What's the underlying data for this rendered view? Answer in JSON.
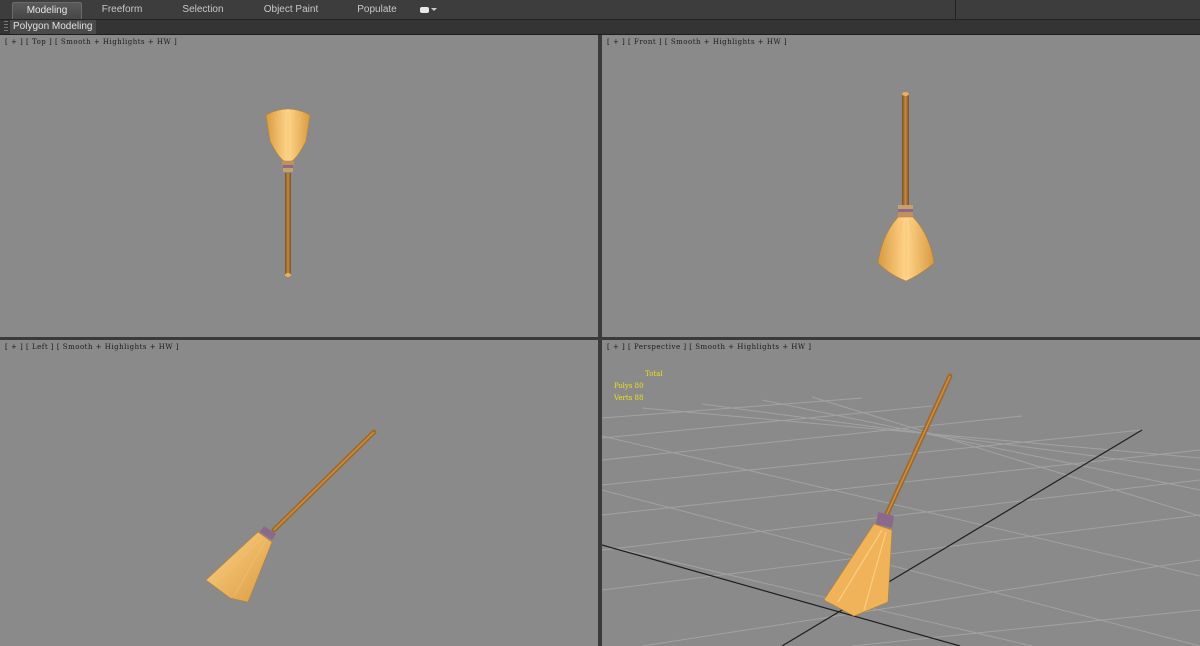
{
  "ribbon": {
    "tabs": [
      {
        "label": "Modeling",
        "active": true
      },
      {
        "label": "Freeform",
        "active": false
      },
      {
        "label": "Selection",
        "active": false
      },
      {
        "label": "Object Paint",
        "active": false
      },
      {
        "label": "Populate",
        "active": false
      }
    ],
    "overflow_icon": "dropdown-toggle-icon"
  },
  "subpanel": {
    "title": "Polygon Modeling"
  },
  "viewports": {
    "top": {
      "label": "[ + ] [ Top ] [ Smooth + Highlights + HW ]"
    },
    "front": {
      "label": "[ + ] [ Front ] [ Smooth + Highlights + HW ]"
    },
    "left": {
      "label": "[ + ] [ Left ] [ Smooth + Highlights + HW ]"
    },
    "perspective": {
      "label": "[ + ] [ Perspective ] [ Smooth + Highlights + HW ]"
    }
  },
  "stats": {
    "header": "Total",
    "polys_label": "Polys",
    "polys_value": "80",
    "verts_label": "Verts",
    "verts_value": "88"
  },
  "colors": {
    "viewport_bg": "#8a8a8a",
    "broom_bristles": "#f0b35a",
    "broom_handle": "#a06a2a",
    "stats_text": "#e7e21a"
  }
}
